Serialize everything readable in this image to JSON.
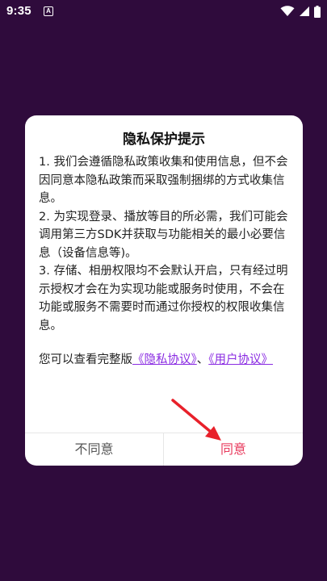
{
  "status_bar": {
    "time": "9:35",
    "notification_letter": "A",
    "icons": [
      "wifi-icon",
      "cellular-signal-icon",
      "battery-icon"
    ]
  },
  "dialog": {
    "title": "隐私保护提示",
    "paragraphs": [
      "1. 我们会遵循隐私政策收集和使用信息，但不会因同意本隐私政策而采取强制捆绑的方式收集信息。",
      "2. 为实现登录、播放等目的所必需，我们可能会调用第三方SDK并获取与功能相关的最小必要信息（设备信息等)。",
      "3. 存储、相册权限均不会默认开启，只有经过明示授权才会在为实现功能或服务时使用，不会在功能或服务不需要时而通过你授权的权限收集信息。"
    ],
    "links_intro": "您可以查看完整版",
    "privacy_link": "《隐私协议》",
    "separator": "、",
    "user_link": "《用户协议》",
    "disagree_label": "不同意",
    "agree_label": "同意"
  },
  "colors": {
    "background": "#2f0b3c",
    "link": "#8a2be2",
    "agree": "#e83a5c",
    "annotation_arrow": "#e8202a"
  }
}
